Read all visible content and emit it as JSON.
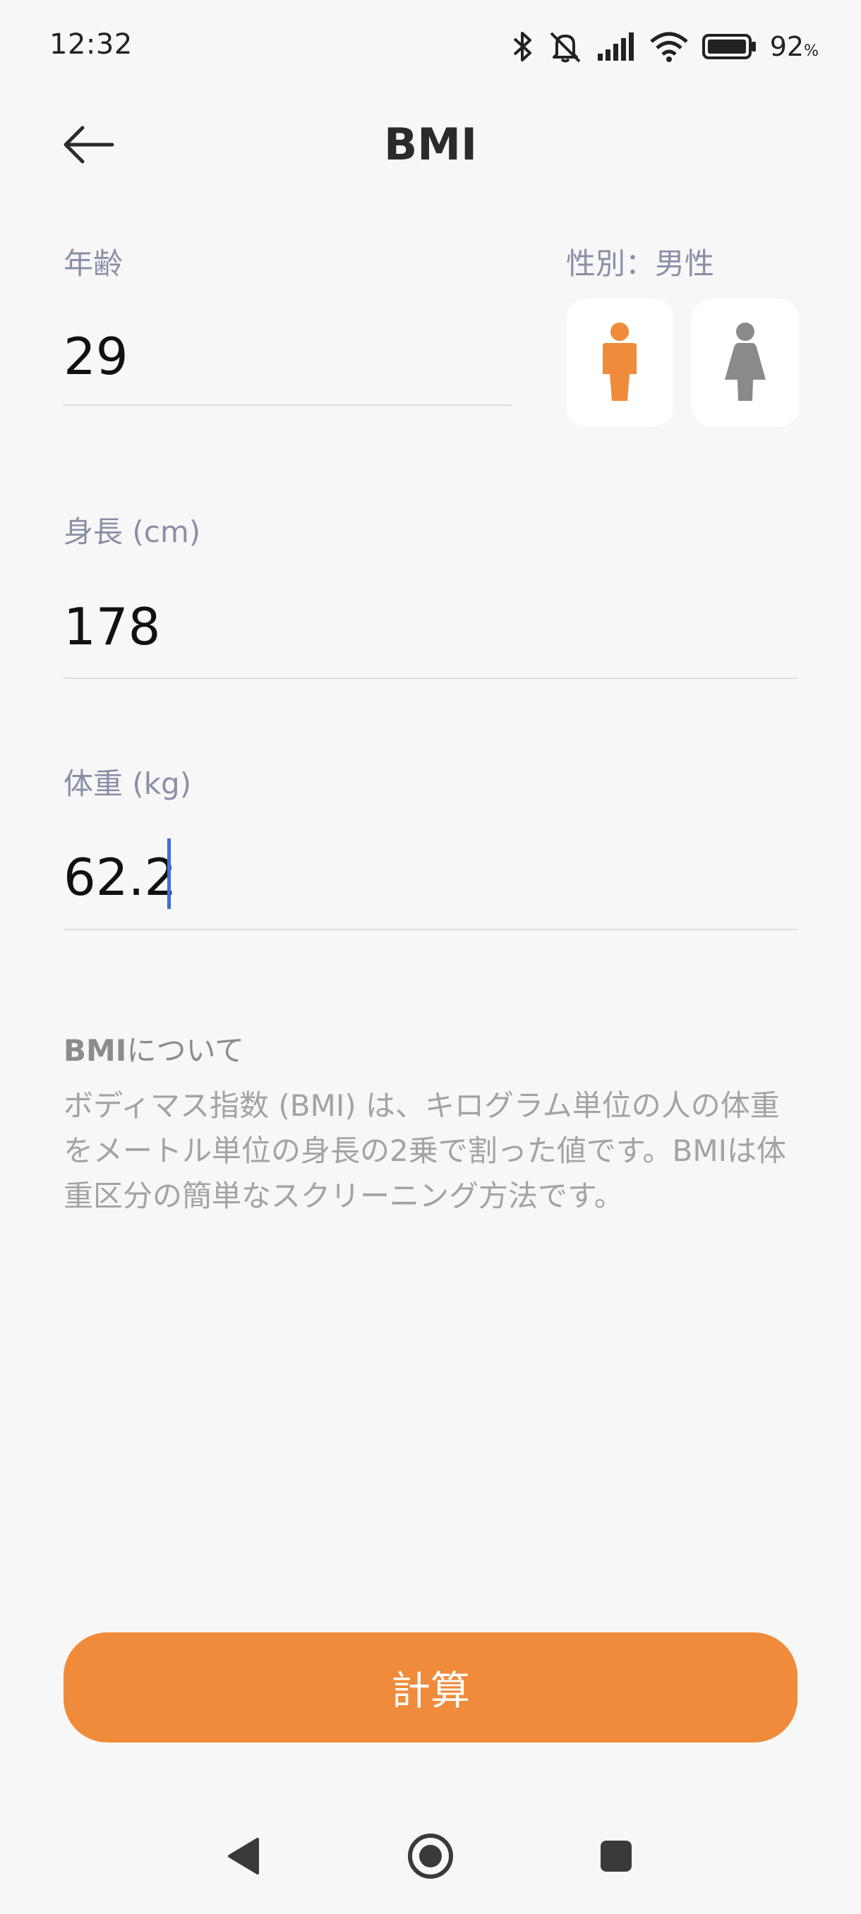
{
  "status_bar": {
    "time": "12:32",
    "battery_percent": "92",
    "battery_unit": "%",
    "icons": [
      "bluetooth-icon",
      "muted-bell-icon",
      "signal-icon",
      "wifi-icon",
      "battery-icon"
    ]
  },
  "header": {
    "title": "BMI",
    "back_icon": "back-arrow-icon"
  },
  "form": {
    "age": {
      "label": "年齢",
      "value": "29"
    },
    "gender": {
      "label": "性別：男性",
      "options": [
        "male-icon",
        "female-icon"
      ],
      "selected": "male"
    },
    "height": {
      "label": "身長 (cm)",
      "value": "178"
    },
    "weight": {
      "label": "体重 (kg)",
      "value": "62.2"
    }
  },
  "about": {
    "title_bold": "BMI",
    "title_rest": "について",
    "text": "ボディマス指数 (BMI) は、キログラム単位の人の体重をメートル単位の身長の2乗で割った値です。BMIは体重区分の簡単なスクリーニング方法です。"
  },
  "actions": {
    "calculate_label": "計算"
  },
  "colors": {
    "accent": "#ef8b3a",
    "label": "#8a8fa8",
    "cursor": "#3d6fd6",
    "background": "#f7f7f7",
    "inactive_icon": "#8a8a8a"
  },
  "nav_bar": {
    "icons": [
      "nav-back-icon",
      "nav-home-icon",
      "nav-recents-icon"
    ]
  }
}
